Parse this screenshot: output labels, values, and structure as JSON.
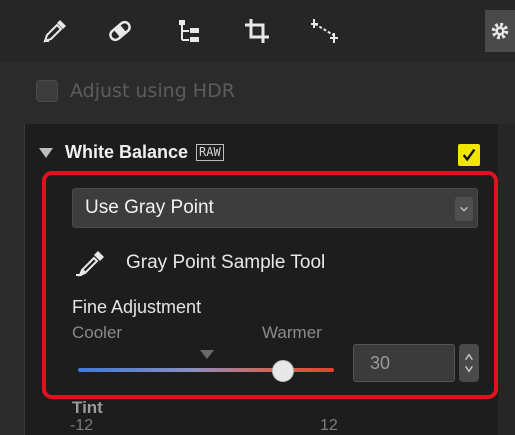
{
  "toolbar": {
    "tools": [
      {
        "icon": "dropper-edit-icon"
      },
      {
        "icon": "retouch-bandage-icon"
      },
      {
        "icon": "hierarchy-icon"
      },
      {
        "icon": "crop-icon"
      },
      {
        "icon": "straighten-icon"
      }
    ],
    "settings_icon": "gear-icon"
  },
  "hdr": {
    "label": "Adjust using HDR",
    "checked": false
  },
  "white_balance": {
    "title": "White Balance",
    "badge": "RAW",
    "enabled": true,
    "mode": "Use Gray Point",
    "sample_tool_label": "Gray Point Sample Tool",
    "fine_adjustment_label": "Fine Adjustment",
    "cooler_label": "Cooler",
    "warmer_label": "Warmer",
    "fine_value": "30",
    "fine_fraction": 0.8,
    "tint_label": "Tint",
    "tint_min": "-12",
    "tint_max": "12"
  },
  "colors": {
    "highlight": "#e0121e",
    "checkbox_active": "#f2e600"
  }
}
